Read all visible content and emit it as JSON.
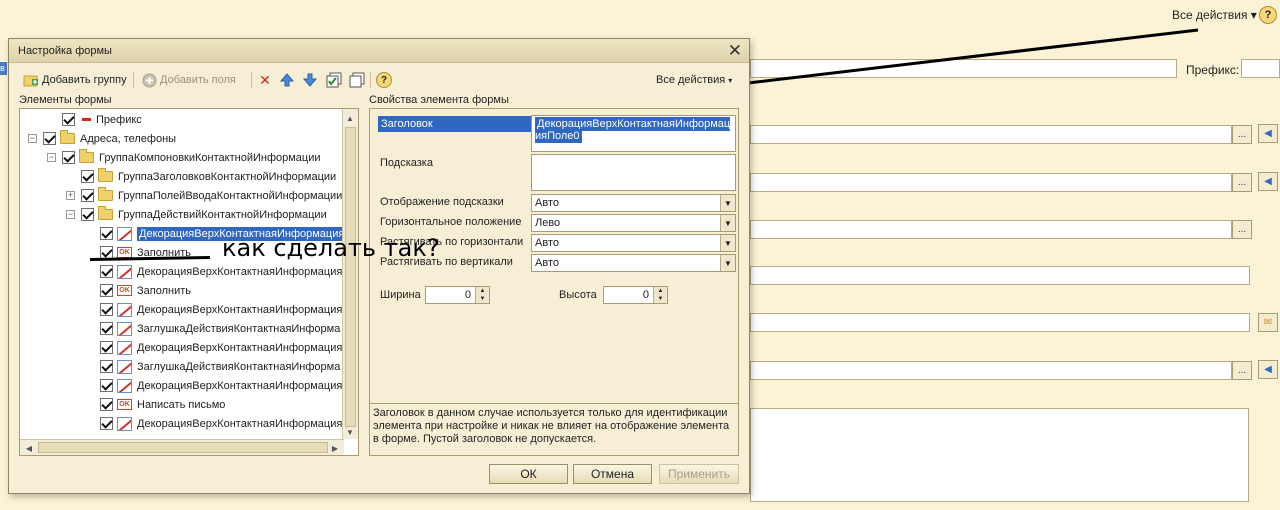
{
  "background": {
    "all_actions": "Все действия",
    "prefix_label": "Префикс:",
    "left_edge_tab": "в",
    "help": "?",
    "dots": "..."
  },
  "dialog": {
    "title": "Настройка формы",
    "toolbar": {
      "add_group": "Добавить группу",
      "add_fields": "Добавить поля",
      "all_actions": "Все действия"
    },
    "elements_label": "Элементы формы",
    "properties_label": "Свойства элемента формы",
    "tree": [
      {
        "text": "Префикс",
        "indent": 2,
        "icon": "minus",
        "expander": ""
      },
      {
        "text": "Адреса, телефоны",
        "indent": 1,
        "icon": "folder",
        "expander": "−"
      },
      {
        "text": "ГруппаКомпоновкиКонтактнойИнформации",
        "indent": 2,
        "icon": "folder",
        "expander": "−"
      },
      {
        "text": "ГруппаЗаголовковКонтактнойИнформации",
        "indent": 3,
        "icon": "folder",
        "expander": ""
      },
      {
        "text": "ГруппаПолейВводаКонтактнойИнформации",
        "indent": 3,
        "icon": "folder",
        "expander": "+"
      },
      {
        "text": "ГруппаДействийКонтактнойИнформации",
        "indent": 3,
        "icon": "folder",
        "expander": "−"
      },
      {
        "text": "ДекорацияВерхКонтактнаяИнформация",
        "indent": 4,
        "icon": "deco",
        "expander": "",
        "selected": true
      },
      {
        "text": "Заполнить",
        "indent": 4,
        "icon": "ok",
        "expander": ""
      },
      {
        "text": "ДекорацияВерхКонтактнаяИнформация",
        "indent": 4,
        "icon": "deco",
        "expander": ""
      },
      {
        "text": "Заполнить",
        "indent": 4,
        "icon": "ok",
        "expander": ""
      },
      {
        "text": "ДекорацияВерхКонтактнаяИнформация",
        "indent": 4,
        "icon": "deco",
        "expander": ""
      },
      {
        "text": "ЗаглушкаДействияКонтактнаяИнформа",
        "indent": 4,
        "icon": "deco",
        "expander": ""
      },
      {
        "text": "ДекорацияВерхКонтактнаяИнформация",
        "indent": 4,
        "icon": "deco",
        "expander": ""
      },
      {
        "text": "ЗаглушкаДействияКонтактнаяИнформа",
        "indent": 4,
        "icon": "deco",
        "expander": ""
      },
      {
        "text": "ДекорацияВерхКонтактнаяИнформация",
        "indent": 4,
        "icon": "deco",
        "expander": ""
      },
      {
        "text": "Написать письмо",
        "indent": 4,
        "icon": "ok",
        "expander": ""
      },
      {
        "text": "ДекорацияВерхКонтактнаяИнформация",
        "indent": 4,
        "icon": "deco",
        "expander": ""
      }
    ],
    "props": {
      "title_label": "Заголовок",
      "title_value": "ДекорацияВерхКонтактнаяИнформацияПоле0",
      "hint_label": "Подсказка",
      "hint_value": "",
      "tooltip_display_label": "Отображение подсказки",
      "tooltip_display_value": "Авто",
      "h_align_label": "Горизонтальное положение",
      "h_align_value": "Лево",
      "h_stretch_label": "Растягивать по горизонтали",
      "h_stretch_value": "Авто",
      "v_stretch_label": "Растягивать по вертикали",
      "v_stretch_value": "Авто",
      "width_label": "Ширина",
      "width_value": "0",
      "height_label": "Высота",
      "height_value": "0"
    },
    "hint_text": "Заголовок в данном случае используется только для идентификации элемента при настройке и никак не влияет на отображение элемента в форме. Пустой заголовок не допускается.",
    "buttons": {
      "ok": "ОК",
      "cancel": "Отмена",
      "apply": "Применить"
    }
  },
  "annotation": "как сделать так?"
}
